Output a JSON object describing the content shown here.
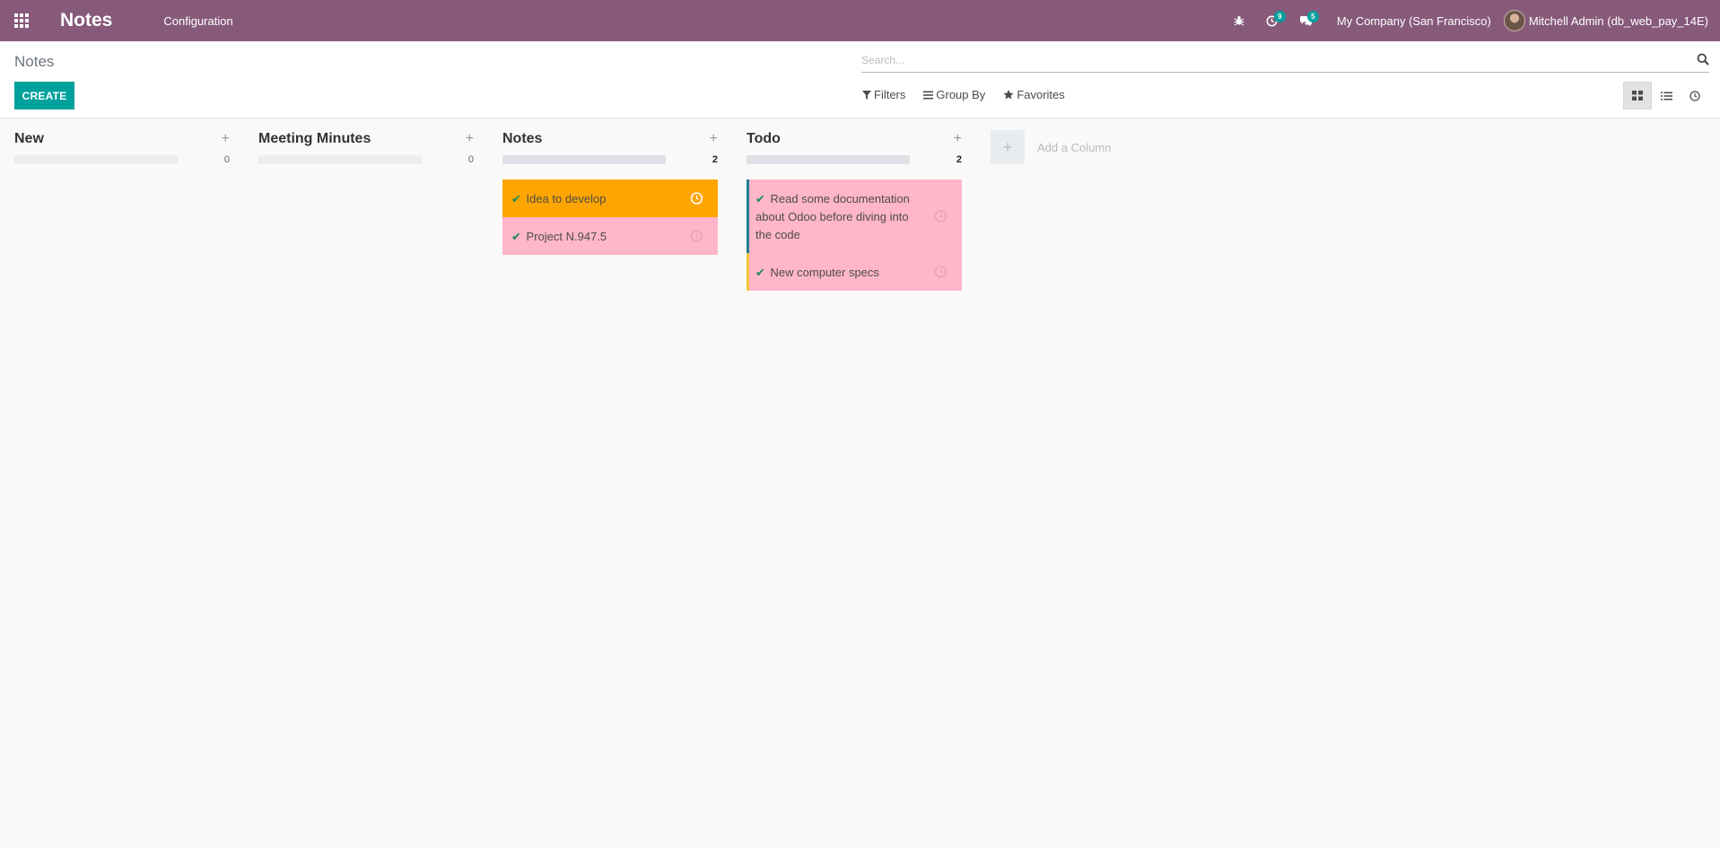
{
  "navbar": {
    "app_title": "Notes",
    "menu": [
      "Configuration"
    ],
    "activity_count": "9",
    "message_count": "5",
    "company": "My Company (San Francisco)",
    "user": "Mitchell Admin (db_web_pay_14E)"
  },
  "control_panel": {
    "breadcrumb": "Notes",
    "create_label": "CREATE",
    "search_placeholder": "Search...",
    "filters_label": "Filters",
    "group_by_label": "Group By",
    "favorites_label": "Favorites"
  },
  "kanban": {
    "columns": [
      {
        "title": "New",
        "count": "0",
        "cards": []
      },
      {
        "title": "Meeting Minutes",
        "count": "0",
        "cards": []
      },
      {
        "title": "Notes",
        "count": "2",
        "cards": [
          {
            "text": "Idea to develop",
            "color": "#ffa500"
          },
          {
            "text": "Project N.947.5",
            "color": "#ffb6c9"
          }
        ]
      },
      {
        "title": "Todo",
        "count": "2",
        "cards": [
          {
            "text": "Read some documentation about Odoo before diving into the code",
            "color": "#ffb6c9"
          },
          {
            "text": "New computer specs",
            "color": "#ffb6c9"
          }
        ]
      }
    ],
    "add_column_label": "Add a Column"
  },
  "colors": {
    "navbar": "#875a7b",
    "primary": "#00a09d"
  }
}
